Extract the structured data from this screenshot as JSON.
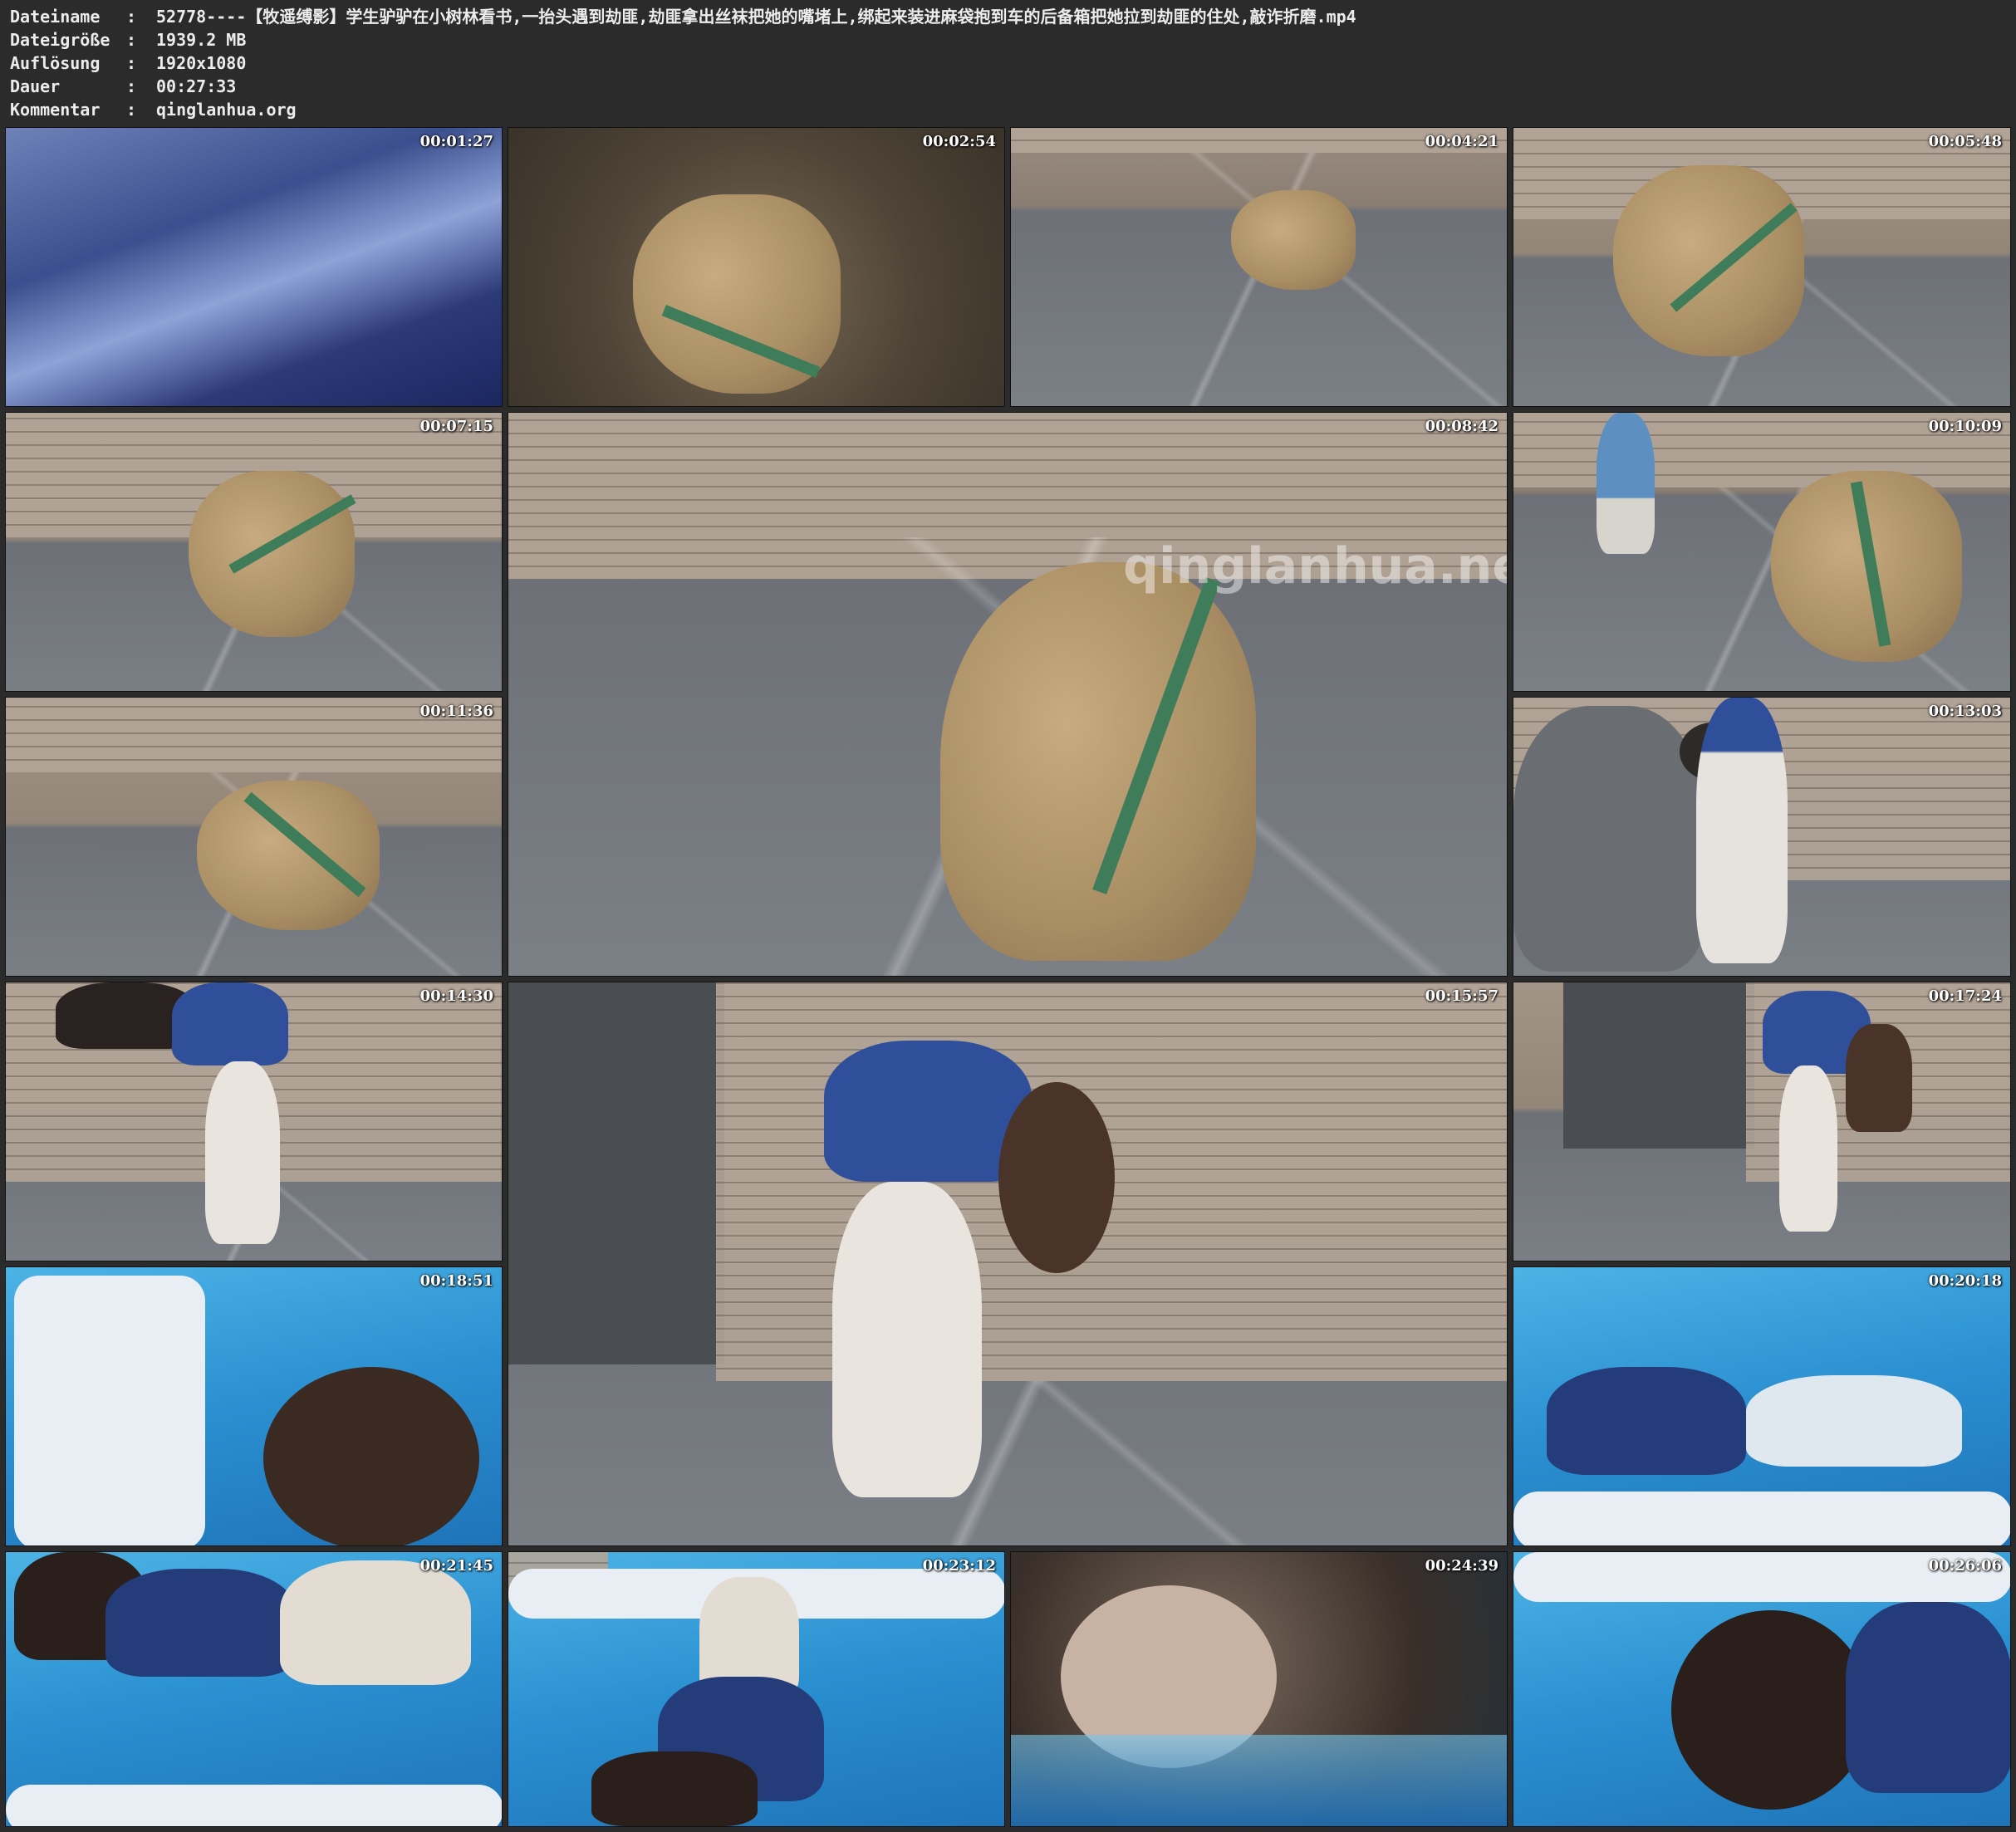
{
  "metadata": {
    "rows": [
      {
        "key": "Dateiname",
        "sep": ":",
        "value": "52778----【牧遥缚影】学生驴驴在小树林看书,一抬头遇到劫匪,劫匪拿出丝袜把她的嘴堵上,绑起来装进麻袋抱到车的后备箱把她拉到劫匪的住处,敲诈折磨.mp4"
      },
      {
        "key": "Dateigröße",
        "sep": ":",
        "value": "1939.2 MB"
      },
      {
        "key": "Auflösung",
        "sep": ":",
        "value": "1920x1080"
      },
      {
        "key": "Dauer",
        "sep": ":",
        "value": "00:27:33"
      },
      {
        "key": "Kommentar",
        "sep": ":",
        "value": "qinglanhua.org"
      }
    ]
  },
  "thumbnails": [
    {
      "timestamp": "00:01:27",
      "scene": "abstract"
    },
    {
      "timestamp": "00:02:54",
      "scene": "forest-sack"
    },
    {
      "timestamp": "00:04:21",
      "scene": "room-sack"
    },
    {
      "timestamp": "00:05:48",
      "scene": "room-sack"
    },
    {
      "timestamp": "00:07:15",
      "scene": "room-sack"
    },
    {
      "timestamp": "00:08:42",
      "scene": "room-sack-large",
      "watermark": "qinglanhua.net"
    },
    {
      "timestamp": "00:10:09",
      "scene": "room-sack-person"
    },
    {
      "timestamp": "00:11:36",
      "scene": "room-sack"
    },
    {
      "timestamp": "00:13:03",
      "scene": "room-two-persons"
    },
    {
      "timestamp": "00:14:30",
      "scene": "room-person"
    },
    {
      "timestamp": "00:15:57",
      "scene": "room-person-large"
    },
    {
      "timestamp": "00:17:24",
      "scene": "room-person"
    },
    {
      "timestamp": "00:18:51",
      "scene": "pool"
    },
    {
      "timestamp": "00:20:18",
      "scene": "pool"
    },
    {
      "timestamp": "00:21:45",
      "scene": "pool"
    },
    {
      "timestamp": "00:23:12",
      "scene": "pool"
    },
    {
      "timestamp": "00:24:39",
      "scene": "face"
    },
    {
      "timestamp": "00:26:06",
      "scene": "pool"
    }
  ]
}
